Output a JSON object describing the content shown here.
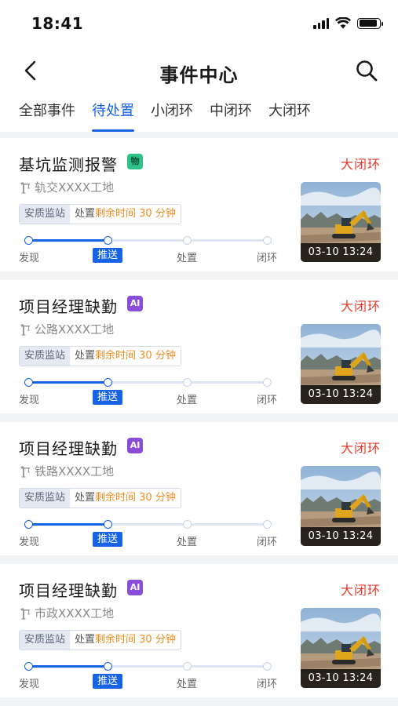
{
  "status_bar": {
    "time": "18:41",
    "battery_level": 0.9
  },
  "nav": {
    "title": "事件中心",
    "back_icon": "chevron-left-icon",
    "search_icon": "search-icon"
  },
  "tabs": [
    {
      "label": "全部事件",
      "active": false
    },
    {
      "label": "待处置",
      "active": true
    },
    {
      "label": "小闭环",
      "active": false
    },
    {
      "label": "中闭环",
      "active": false
    },
    {
      "label": "大闭环",
      "active": false
    }
  ],
  "colors": {
    "accent": "#1663e6",
    "loop_red": "#e23a2e",
    "highlight_orange": "#f08c1e",
    "tag_wu": "#2ec28a",
    "tag_ai": "#8a4dd8"
  },
  "steps": [
    "发现",
    "推送",
    "处置",
    "闭环"
  ],
  "events": [
    {
      "title": "基坑监测报警",
      "tag": "物",
      "tag_type": "wu",
      "loop": "大闭环",
      "site": "轨交XXXX工地",
      "station": "安质监站",
      "action_prefix": "处置",
      "remaining": "剩余时间 30 分钟",
      "current_step": 1,
      "timestamp": "03-10 13:24"
    },
    {
      "title": "项目经理缺勤",
      "tag": "AI",
      "tag_type": "ai",
      "loop": "大闭环",
      "site": "公路XXXX工地",
      "station": "安质监站",
      "action_prefix": "处置",
      "remaining": "剩余时间 30 分钟",
      "current_step": 1,
      "timestamp": "03-10 13:24"
    },
    {
      "title": "项目经理缺勤",
      "tag": "AI",
      "tag_type": "ai",
      "loop": "大闭环",
      "site": "铁路XXXX工地",
      "station": "安质监站",
      "action_prefix": "处置",
      "remaining": "剩余时间 30 分钟",
      "current_step": 1,
      "timestamp": "03-10 13:24"
    },
    {
      "title": "项目经理缺勤",
      "tag": "AI",
      "tag_type": "ai",
      "loop": "大闭环",
      "site": "市政XXXX工地",
      "station": "安质监站",
      "action_prefix": "处置",
      "remaining": "剩余时间 30 分钟",
      "current_step": 1,
      "timestamp": "03-10 13:24"
    }
  ]
}
